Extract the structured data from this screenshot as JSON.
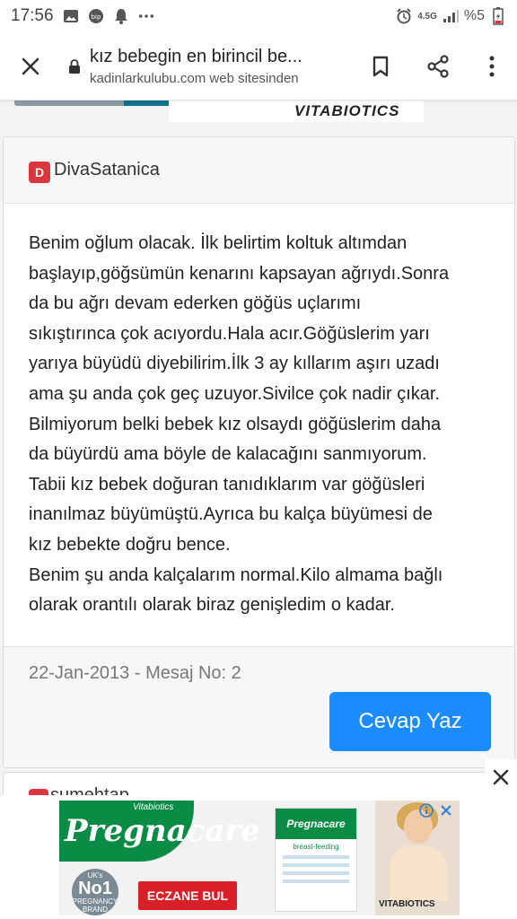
{
  "status_bar": {
    "time": "17:56",
    "network": "4.5G",
    "battery": "%5"
  },
  "toolbar": {
    "title": "kız bebegin en birincil be...",
    "subtitle": "kadinlarkulubu.com web sitesinden"
  },
  "top_ad": {
    "brand": "VITABIOTICS"
  },
  "post": {
    "avatar_letter": "D",
    "username": "DivaSatanica",
    "text": "Benim oğlum olacak. İlk belirtim koltuk altımdan\nbaşlayıp,göğsümün kenarını kapsayan ağrıydı.Sonra\nda bu ağrı devam ederken göğüs uçlarımı\nsıkıştırınca çok acıyordu.Hala acır.Göğüslerim yarı\nyarıya büyüdü diyebilirim.İlk 3 ay kıllarım aşırı uzadı\nama şu anda çok geç uzuyor.Sivilce çok nadir çıkar.\nBilmiyorum belki bebek kız olsaydı göğüslerim daha\nda büyürdü ama böyle de kalacağını sanmıyorum.\nTabii kız bebek doğuran tanıdıklarım var göğüsleri\ninanılmaz büyümüştü.Ayrıca bu kalça büyümesi de\nkız bebekte doğru bence.\nBenim şu anda kalçalarım normal.Kilo almama bağlı\nolarak orantılı olarak biraz genişledim o kadar.",
    "meta": "22-Jan-2013 - Mesaj No: 2",
    "reply_label": "Cevap Yaz"
  },
  "next_post": {
    "username": "sumehtap"
  },
  "ad_banner": {
    "logo_tag": "Vitabiotics",
    "logo_word": "Pregnacare",
    "badge_top": "UK's",
    "badge_no": "No1",
    "badge_bottom": "PREGNANCY BRAND",
    "cta": "ECZANE BUL",
    "box_title": "Pregnacare",
    "box_sub": "breast-feeding",
    "brand": "VITABIOTICS"
  },
  "colors": {
    "accent": "#1a8cff",
    "avatar": "#d9363e",
    "pregnacare_green": "#0b8c45",
    "cta_red": "#d92027"
  }
}
